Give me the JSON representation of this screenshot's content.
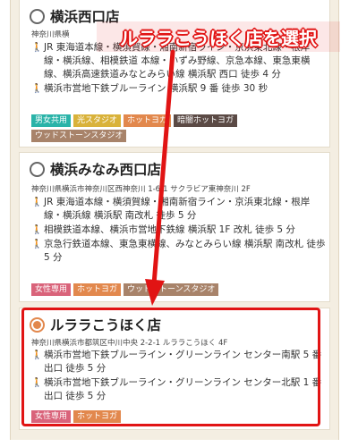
{
  "callout": {
    "text": "ルララこうほく店を選択"
  },
  "colors": {
    "radio_selected": "#e2884d",
    "annotation_red": "#e11414",
    "walk_icon": "#e2884d"
  },
  "stores": [
    {
      "name": "横浜西口店",
      "selected": false,
      "address": "神奈川県横",
      "access": [
        {
          "icon": "walk-icon",
          "text": "JR 東海道本線・横須賀線・湘南新宿ライン・京浜東北線・根岸線・横浜線、相模鉄道 本線・いずみ野線、京急本線、東急東横線、横浜高速鉄道みなとみらい線 横浜駅 西口 徒歩 4 分"
        },
        {
          "icon": "walk-icon",
          "text": "横浜市営地下鉄ブルーライン 横浜駅 9 番 徒歩 30 秒"
        }
      ],
      "tags": [
        {
          "label": "男女共用",
          "color": "#2ab3a8"
        },
        {
          "label": "光スタジオ",
          "color": "#d9b23a"
        },
        {
          "label": "ホットヨガ",
          "color": "#e2884d"
        },
        {
          "label": "暗闇ホットヨガ",
          "color": "#5b4a45"
        },
        {
          "label": "ウッドストーンスタジオ",
          "color": "#a8836a"
        }
      ]
    },
    {
      "name": "横浜みなみ西口店",
      "selected": false,
      "address": "神奈川県横浜市神奈川区西神奈川 1-6-1 サクラビア東神奈川 2F",
      "access": [
        {
          "icon": "walk-icon",
          "text": "JR 東海道本線・横須賀線・湘南新宿ライン・京浜東北線・根岸線・横浜線 横浜駅 南改札 徒歩 5 分"
        },
        {
          "icon": "walk-icon",
          "text": "相模鉄道本線、横浜市営地下鉄線 横浜駅 1F 改札 徒歩 5 分"
        },
        {
          "icon": "walk-icon",
          "text": "京急行鉄道本線、東急東横線、みなとみらい線 横浜駅 南改札 徒歩 5 分"
        }
      ],
      "tags": [
        {
          "label": "女性専用",
          "color": "#d9637a"
        },
        {
          "label": "ホットヨガ",
          "color": "#e2884d"
        },
        {
          "label": "ウッドストーンスタジオ",
          "color": "#a8836a"
        }
      ]
    },
    {
      "name": "ルララこうほく店",
      "selected": true,
      "address": "神奈川県横浜市都筑区中川中央 2-2-1 ルララこうほく 4F",
      "access": [
        {
          "icon": "walk-icon",
          "text": "横浜市営地下鉄ブルーライン・グリーンライン センター南駅 5 番出口 徒歩 5 分"
        },
        {
          "icon": "walk-icon",
          "text": "横浜市営地下鉄ブルーライン・グリーンライン センター北駅 1 番出口 徒歩 5 分"
        }
      ],
      "tags": [
        {
          "label": "女性専用",
          "color": "#d9637a"
        },
        {
          "label": "ホットヨガ",
          "color": "#e2884d"
        }
      ]
    }
  ]
}
